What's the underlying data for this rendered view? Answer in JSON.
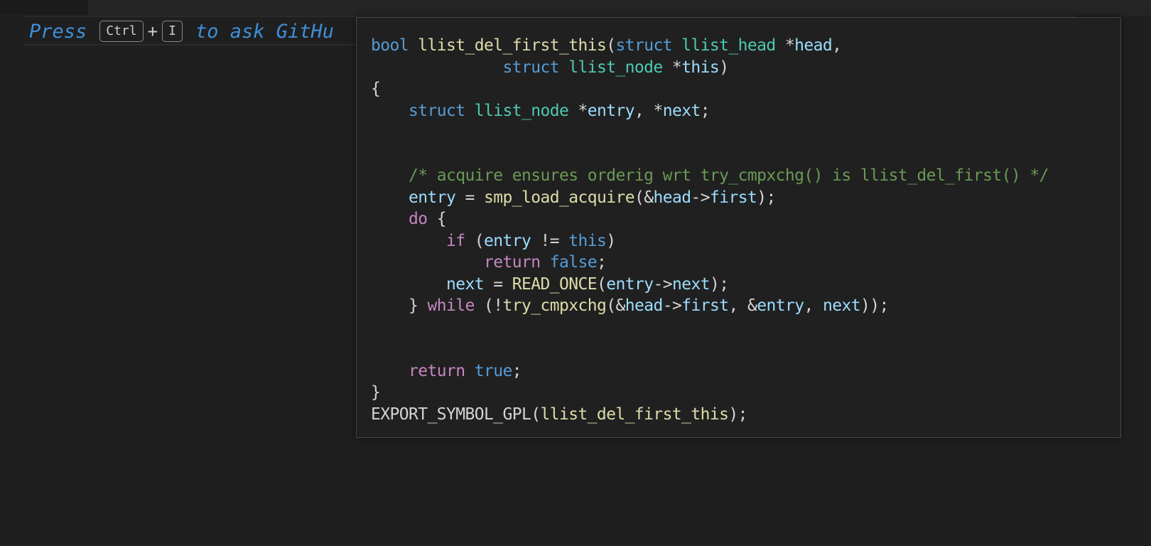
{
  "hint": {
    "press": "Press",
    "key1": "Ctrl",
    "plus": "+",
    "key2": "I",
    "rest": "to ask GitHu"
  },
  "hover": {
    "lines": [
      [
        [
          "kw",
          "bool"
        ],
        [
          "pun",
          " "
        ],
        [
          "fn",
          "llist_del_first_this"
        ],
        [
          "pun",
          "("
        ],
        [
          "kw",
          "struct"
        ],
        [
          "pun",
          " "
        ],
        [
          "ty",
          "llist_head"
        ],
        [
          "pun",
          " *"
        ],
        [
          "prm",
          "head"
        ],
        [
          "pun",
          ","
        ]
      ],
      [
        [
          "pun",
          "              "
        ],
        [
          "kw",
          "struct"
        ],
        [
          "pun",
          " "
        ],
        [
          "ty",
          "llist_node"
        ],
        [
          "pun",
          " *"
        ],
        [
          "prm",
          "this"
        ],
        [
          "pun",
          ")"
        ]
      ],
      [
        [
          "pun",
          "{"
        ]
      ],
      [
        [
          "pun",
          "    "
        ],
        [
          "kw",
          "struct"
        ],
        [
          "pun",
          " "
        ],
        [
          "ty",
          "llist_node"
        ],
        [
          "pun",
          " *"
        ],
        [
          "var",
          "entry"
        ],
        [
          "pun",
          ", *"
        ],
        [
          "var",
          "next"
        ],
        [
          "pun",
          ";"
        ]
      ],
      [],
      [],
      [
        [
          "pun",
          "    "
        ],
        [
          "cmt",
          "/* acquire ensures orderig wrt try_cmpxchg() is llist_del_first() */"
        ]
      ],
      [
        [
          "pun",
          "    "
        ],
        [
          "var",
          "entry"
        ],
        [
          "pun",
          " = "
        ],
        [
          "fn",
          "smp_load_acquire"
        ],
        [
          "pun",
          "(&"
        ],
        [
          "prm",
          "head"
        ],
        [
          "pun",
          "->"
        ],
        [
          "var",
          "first"
        ],
        [
          "pun",
          ");"
        ]
      ],
      [
        [
          "pun",
          "    "
        ],
        [
          "ctl",
          "do"
        ],
        [
          "pun",
          " {"
        ]
      ],
      [
        [
          "pun",
          "        "
        ],
        [
          "ctl",
          "if"
        ],
        [
          "pun",
          " ("
        ],
        [
          "var",
          "entry"
        ],
        [
          "pun",
          " != "
        ],
        [
          "kw",
          "this"
        ],
        [
          "pun",
          ")"
        ]
      ],
      [
        [
          "pun",
          "            "
        ],
        [
          "ctl",
          "return"
        ],
        [
          "pun",
          " "
        ],
        [
          "kw",
          "false"
        ],
        [
          "pun",
          ";"
        ]
      ],
      [
        [
          "pun",
          "        "
        ],
        [
          "var",
          "next"
        ],
        [
          "pun",
          " = "
        ],
        [
          "mac",
          "READ_ONCE"
        ],
        [
          "pun",
          "("
        ],
        [
          "var",
          "entry"
        ],
        [
          "pun",
          "->"
        ],
        [
          "var",
          "next"
        ],
        [
          "pun",
          ");"
        ]
      ],
      [
        [
          "pun",
          "    } "
        ],
        [
          "ctl",
          "while"
        ],
        [
          "pun",
          " (!"
        ],
        [
          "fn",
          "try_cmpxchg"
        ],
        [
          "pun",
          "(&"
        ],
        [
          "prm",
          "head"
        ],
        [
          "pun",
          "->"
        ],
        [
          "var",
          "first"
        ],
        [
          "pun",
          ", &"
        ],
        [
          "var",
          "entry"
        ],
        [
          "pun",
          ", "
        ],
        [
          "var",
          "next"
        ],
        [
          "pun",
          "));"
        ]
      ],
      [],
      [],
      [
        [
          "pun",
          "    "
        ],
        [
          "ctl",
          "return"
        ],
        [
          "pun",
          " "
        ],
        [
          "kw",
          "true"
        ],
        [
          "pun",
          ";"
        ]
      ],
      [
        [
          "pun",
          "}"
        ]
      ],
      [
        [
          "pun",
          "EXPORT_SYMBOL_GPL("
        ],
        [
          "fn",
          "llist_del_first_this"
        ],
        [
          "pun",
          ");"
        ]
      ]
    ]
  }
}
